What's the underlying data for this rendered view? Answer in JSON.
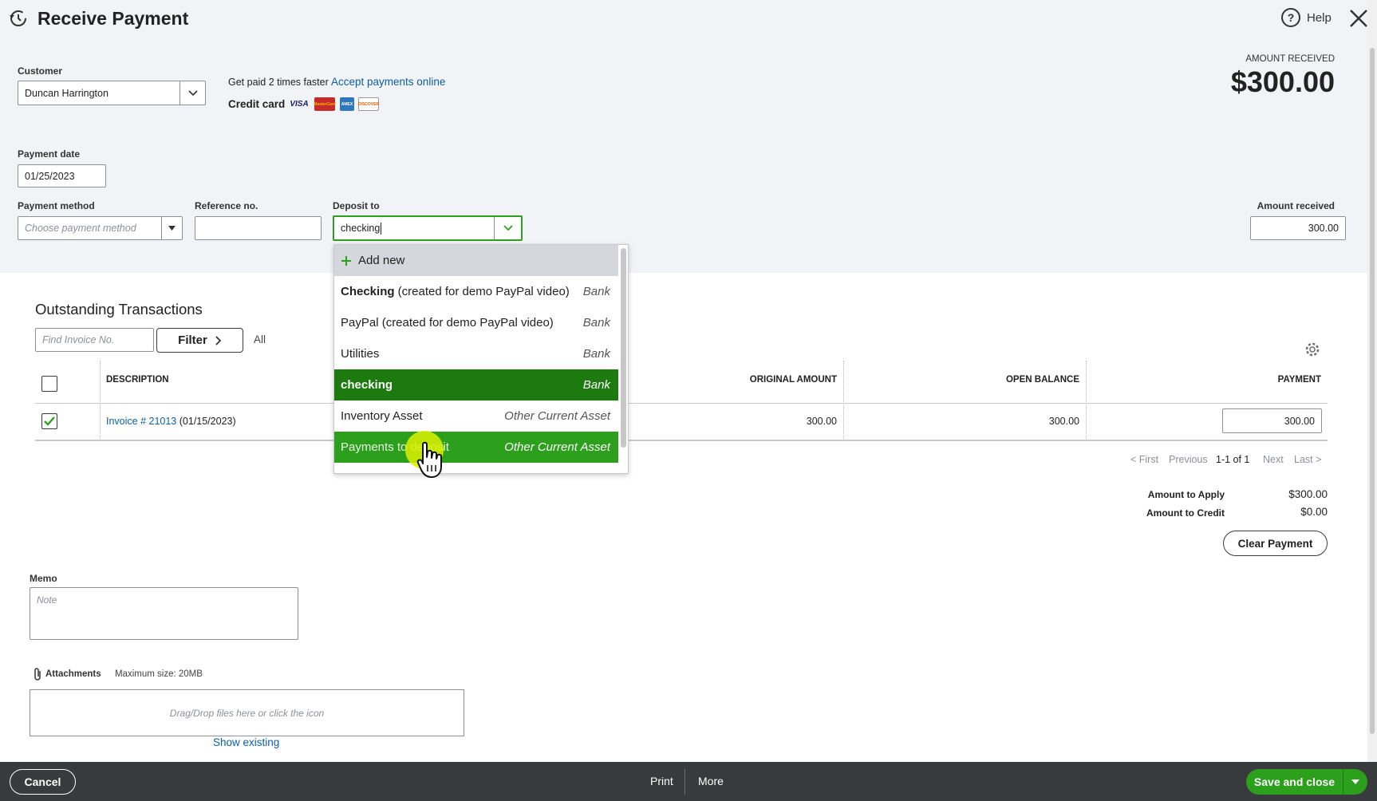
{
  "header": {
    "title": "Receive Payment",
    "help_label": "Help",
    "amount_received_label": "AMOUNT RECEIVED",
    "amount_received_value": "$300.00"
  },
  "customer": {
    "label": "Customer",
    "value": "Duncan Harrington"
  },
  "promo": {
    "get_paid": "Get paid 2 times faster",
    "accept_link": "Accept payments online",
    "credit_card_label": "Credit card",
    "cards": [
      "VISA",
      "MasterCard",
      "AMEX",
      "DISCOVER"
    ]
  },
  "payment_date": {
    "label": "Payment date",
    "value": "01/25/2023"
  },
  "payment_method": {
    "label": "Payment method",
    "placeholder": "Choose payment method"
  },
  "reference": {
    "label": "Reference no.",
    "value": ""
  },
  "deposit_to": {
    "label": "Deposit to",
    "value": "checking",
    "add_new": "Add new",
    "options": [
      {
        "name_bold": "Checking",
        "name_rest": " (created for demo PayPal video)",
        "type": "Bank",
        "state": ""
      },
      {
        "name_bold": "",
        "name_rest": "PayPal (created for demo PayPal video)",
        "type": "Bank",
        "state": ""
      },
      {
        "name_bold": "",
        "name_rest": "Utilities",
        "type": "Bank",
        "state": ""
      },
      {
        "name_bold": "checking",
        "name_rest": "",
        "type": "Bank",
        "state": "selected"
      },
      {
        "name_bold": "",
        "name_rest": "Inventory Asset",
        "type": "Other Current Asset",
        "state": ""
      },
      {
        "name_bold": "",
        "name_rest": "Payments to deposit",
        "type": "Other Current Asset",
        "state": "hover"
      }
    ]
  },
  "amount_received": {
    "label": "Amount received",
    "value": "300.00"
  },
  "outstanding": {
    "title": "Outstanding Transactions",
    "find_placeholder": "Find Invoice No.",
    "filter_label": "Filter",
    "all_label": "All",
    "columns": {
      "description": "DESCRIPTION",
      "original_amount": "ORIGINAL AMOUNT",
      "open_balance": "OPEN BALANCE",
      "payment": "PAYMENT"
    },
    "rows": [
      {
        "invoice_link": "Invoice # 21013",
        "date": "(01/15/2023)",
        "original_amount": "300.00",
        "open_balance": "300.00",
        "payment": "300.00",
        "checked": true
      }
    ],
    "pager": {
      "first": "< First",
      "previous": "Previous",
      "range": "1-1 of 1",
      "next": "Next",
      "last": "Last >"
    }
  },
  "summary": {
    "apply_label": "Amount to Apply",
    "apply_value": "$300.00",
    "credit_label": "Amount to Credit",
    "credit_value": "$0.00",
    "clear_label": "Clear Payment"
  },
  "memo": {
    "label": "Memo",
    "placeholder": "Note"
  },
  "attachments": {
    "label": "Attachments",
    "max_size": "Maximum size: 20MB",
    "dropzone": "Drag/Drop files here or click the icon",
    "show_existing": "Show existing"
  },
  "footer": {
    "cancel": "Cancel",
    "print": "Print",
    "more": "More",
    "save": "Save and close"
  },
  "colors": {
    "brand_green": "#2ca01c",
    "selected_green": "#1c7a0e",
    "link_blue": "#0b5fa5",
    "footer_bg": "#393a3d"
  }
}
